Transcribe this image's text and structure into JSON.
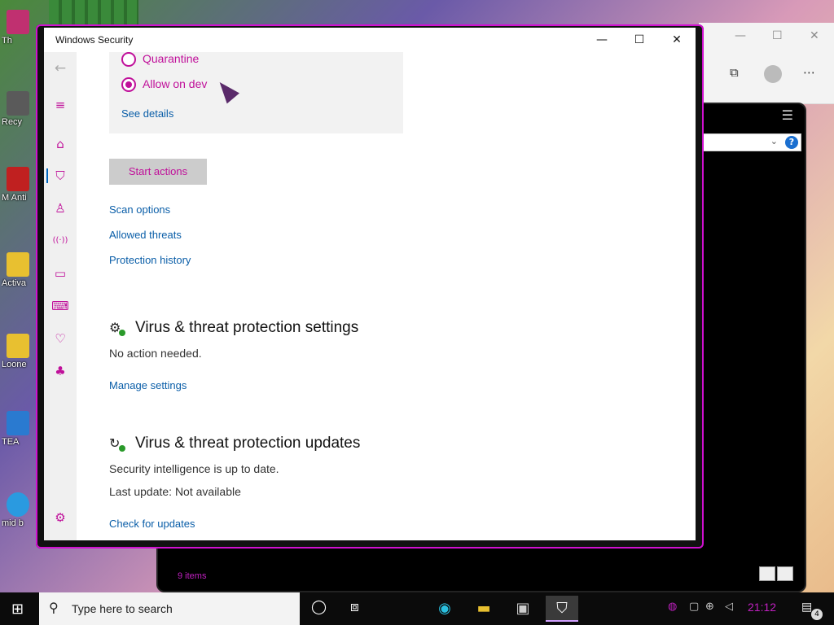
{
  "desktop": {
    "icons": [
      {
        "label": "Th",
        "color": "#c03070"
      },
      {
        "label": "Recy",
        "color": "#5a5a5a"
      },
      {
        "label": "M Anti",
        "color": "#c02020"
      },
      {
        "label": "Activa",
        "color": "#e8c030"
      },
      {
        "label": "Loone",
        "color": "#e8c030"
      },
      {
        "label": "TEA",
        "color": "#2a7ad0"
      },
      {
        "label": "mid b",
        "color": "#2a9ae0"
      }
    ]
  },
  "background_window": {
    "status_text": "9 items",
    "help_label": "?"
  },
  "window": {
    "title": "Windows Security",
    "minimize": "—",
    "maximize": "☐",
    "close": "✕"
  },
  "sidebar": {
    "items": [
      {
        "name": "back-arrow-icon",
        "glyph": "←"
      },
      {
        "name": "menu-icon",
        "glyph": "≡"
      },
      {
        "name": "home-icon",
        "glyph": "⌂"
      },
      {
        "name": "shield-icon",
        "glyph": "⛉"
      },
      {
        "name": "person-icon",
        "glyph": "♙"
      },
      {
        "name": "wireless-icon",
        "glyph": "((·))"
      },
      {
        "name": "app-browser-icon",
        "glyph": "▭"
      },
      {
        "name": "laptop-icon",
        "glyph": "⌨"
      },
      {
        "name": "heart-icon",
        "glyph": "♡"
      },
      {
        "name": "family-icon",
        "glyph": "♣"
      },
      {
        "name": "settings-icon",
        "glyph": "⚙"
      }
    ]
  },
  "actions": {
    "quarantine_label": "Quarantine",
    "allow_label": "Allow on device",
    "allow_visible": "Allow on dev",
    "see_details": "See details",
    "start_actions": "Start actions"
  },
  "links": {
    "scan_options": "Scan options",
    "allowed_threats": "Allowed threats",
    "protection_history": "Protection history"
  },
  "settings_section": {
    "title": "Virus & threat protection settings",
    "status": "No action needed.",
    "link": "Manage settings"
  },
  "updates_section": {
    "title": "Virus & threat protection updates",
    "status": "Security intelligence is up to date.",
    "last_update": "Last update: Not available",
    "link": "Check for updates"
  },
  "taskbar": {
    "search_placeholder": "Type here to search",
    "clock": "21:12",
    "notification_count": "4"
  },
  "colors": {
    "accent": "#c0109a",
    "link": "#0a5ea8",
    "frame_glow": "#d010d0"
  }
}
